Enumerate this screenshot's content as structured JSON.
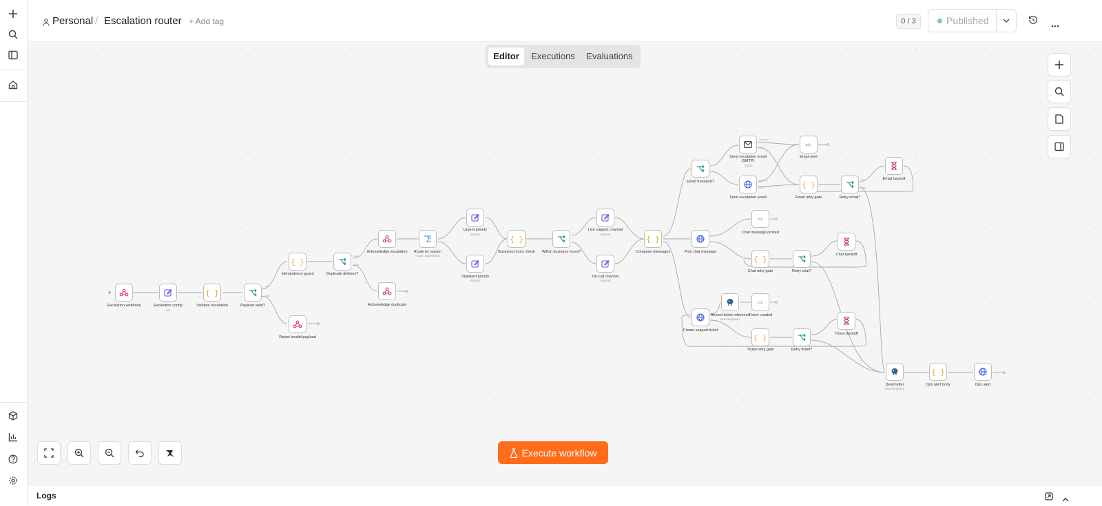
{
  "breadcrumb": {
    "project": "Personal",
    "separator": "/",
    "workflow_name": "Escalation router",
    "add_tag": "+ Add tag"
  },
  "header_right": {
    "counter": "0 / 3",
    "publish_label": "Published"
  },
  "tabs": [
    "Editor",
    "Executions",
    "Evaluations"
  ],
  "active_tab": "Editor",
  "execute_button": "Execute workflow",
  "logs_label": "Logs",
  "icons": {
    "left_rail": [
      "plus-icon",
      "search-icon",
      "sidebar-icon",
      "home-icon",
      "packages-icon",
      "chart-icon",
      "help-icon",
      "settings-icon"
    ],
    "right_tools": [
      "plus-icon",
      "search-icon",
      "note-icon",
      "panel-icon"
    ],
    "bottom_tools": [
      "fit-view-icon",
      "zoom-in-icon",
      "zoom-out-icon",
      "undo-icon",
      "tidy-up-icon"
    ]
  },
  "colors": {
    "accent": "#ff6d1a",
    "published_dot": "#29a37a",
    "webhook": "#e23b6b",
    "set": "#5b5ce0",
    "code": "#f5a623",
    "if": "#0f8b8d",
    "http": "#3b5bdb",
    "wait": "#c0334d",
    "email": "#333333",
    "noop": "#aaaaaa"
  },
  "nodes": [
    {
      "id": "webhook",
      "label": "Escalation webhook",
      "sub": "",
      "icon": "webhook"
    },
    {
      "id": "config",
      "label": "Escalation config",
      "sub": "set",
      "icon": "set"
    },
    {
      "id": "validate",
      "label": "Validate escalation",
      "sub": "",
      "icon": "code"
    },
    {
      "id": "payload_valid",
      "label": "Payload valid?",
      "sub": "",
      "icon": "if"
    },
    {
      "id": "idempotency",
      "label": "Idempotency guard",
      "sub": "",
      "icon": "code"
    },
    {
      "id": "reject",
      "label": "Reject invalid payload",
      "sub": "",
      "icon": "webhook"
    },
    {
      "id": "duplicate",
      "label": "Duplicate delivery?",
      "sub": "",
      "icon": "if"
    },
    {
      "id": "ack_esc",
      "label": "Acknowledge escalation",
      "sub": "",
      "icon": "webhook"
    },
    {
      "id": "ack_dup",
      "label": "Acknowledge duplicate",
      "sub": "",
      "icon": "webhook"
    },
    {
      "id": "route",
      "label": "Route by reason",
      "sub": "mode: Expression",
      "icon": "switch"
    },
    {
      "id": "urgent",
      "label": "Urgent priority",
      "sub": "manual",
      "icon": "set"
    },
    {
      "id": "standard",
      "label": "Standard priority",
      "sub": "manual",
      "icon": "set"
    },
    {
      "id": "bh_check",
      "label": "Business hours check",
      "sub": "",
      "icon": "code"
    },
    {
      "id": "within_bh",
      "label": "Within business hours?",
      "sub": "",
      "icon": "if"
    },
    {
      "id": "live",
      "label": "Live support channel",
      "sub": "manual",
      "icon": "set"
    },
    {
      "id": "oncall",
      "label": "On-call channel",
      "sub": "manual",
      "icon": "set"
    },
    {
      "id": "compose",
      "label": "Compose messages",
      "sub": "",
      "icon": "code"
    },
    {
      "id": "email_transport",
      "label": "Email transport?",
      "sub": "",
      "icon": "if"
    },
    {
      "id": "smtp",
      "label": "Send escalation email (SMTP)",
      "sub": "Send",
      "icon": "email"
    },
    {
      "id": "send_email",
      "label": "Send escalation email",
      "sub": "",
      "icon": "http"
    },
    {
      "id": "email_sent",
      "label": "Email sent",
      "sub": "",
      "icon": "noop"
    },
    {
      "id": "email_retry",
      "label": "Email retry gate",
      "sub": "",
      "icon": "code"
    },
    {
      "id": "retry_email",
      "label": "Retry email?",
      "sub": "",
      "icon": "if"
    },
    {
      "id": "email_backoff",
      "label": "Email backoff",
      "sub": "",
      "icon": "wait"
    },
    {
      "id": "post_chat",
      "label": "Post chat message",
      "sub": "",
      "icon": "http"
    },
    {
      "id": "chat_posted",
      "label": "Chat message posted",
      "sub": "",
      "icon": "noop"
    },
    {
      "id": "chat_retry",
      "label": "Chat retry gate",
      "sub": "",
      "icon": "code"
    },
    {
      "id": "retry_chat",
      "label": "Retry chat?",
      "sub": "",
      "icon": "if"
    },
    {
      "id": "chat_backoff",
      "label": "Chat backoff",
      "sub": "",
      "icon": "wait"
    },
    {
      "id": "create_ticket",
      "label": "Create support ticket",
      "sub": "",
      "icon": "http"
    },
    {
      "id": "record_ticket",
      "label": "Record ticket reference",
      "sub": "executeQuery",
      "icon": "postgres"
    },
    {
      "id": "ticket_created",
      "label": "Ticket created",
      "sub": "",
      "icon": "noop"
    },
    {
      "id": "ticket_retry",
      "label": "Ticket retry gate",
      "sub": "",
      "icon": "code"
    },
    {
      "id": "retry_ticket",
      "label": "Retry ticket?",
      "sub": "",
      "icon": "if"
    },
    {
      "id": "ticket_backoff",
      "label": "Ticket backoff",
      "sub": "",
      "icon": "wait"
    },
    {
      "id": "dead_letter",
      "label": "Dead letter",
      "sub": "executeQuery",
      "icon": "postgres"
    },
    {
      "id": "ops_body",
      "label": "Ops alert body",
      "sub": "",
      "icon": "code"
    },
    {
      "id": "ops_alert",
      "label": "Ops alert",
      "sub": "",
      "icon": "http"
    }
  ],
  "port_labels": {
    "true": "true",
    "false": "false",
    "success": "success",
    "error": "error"
  }
}
